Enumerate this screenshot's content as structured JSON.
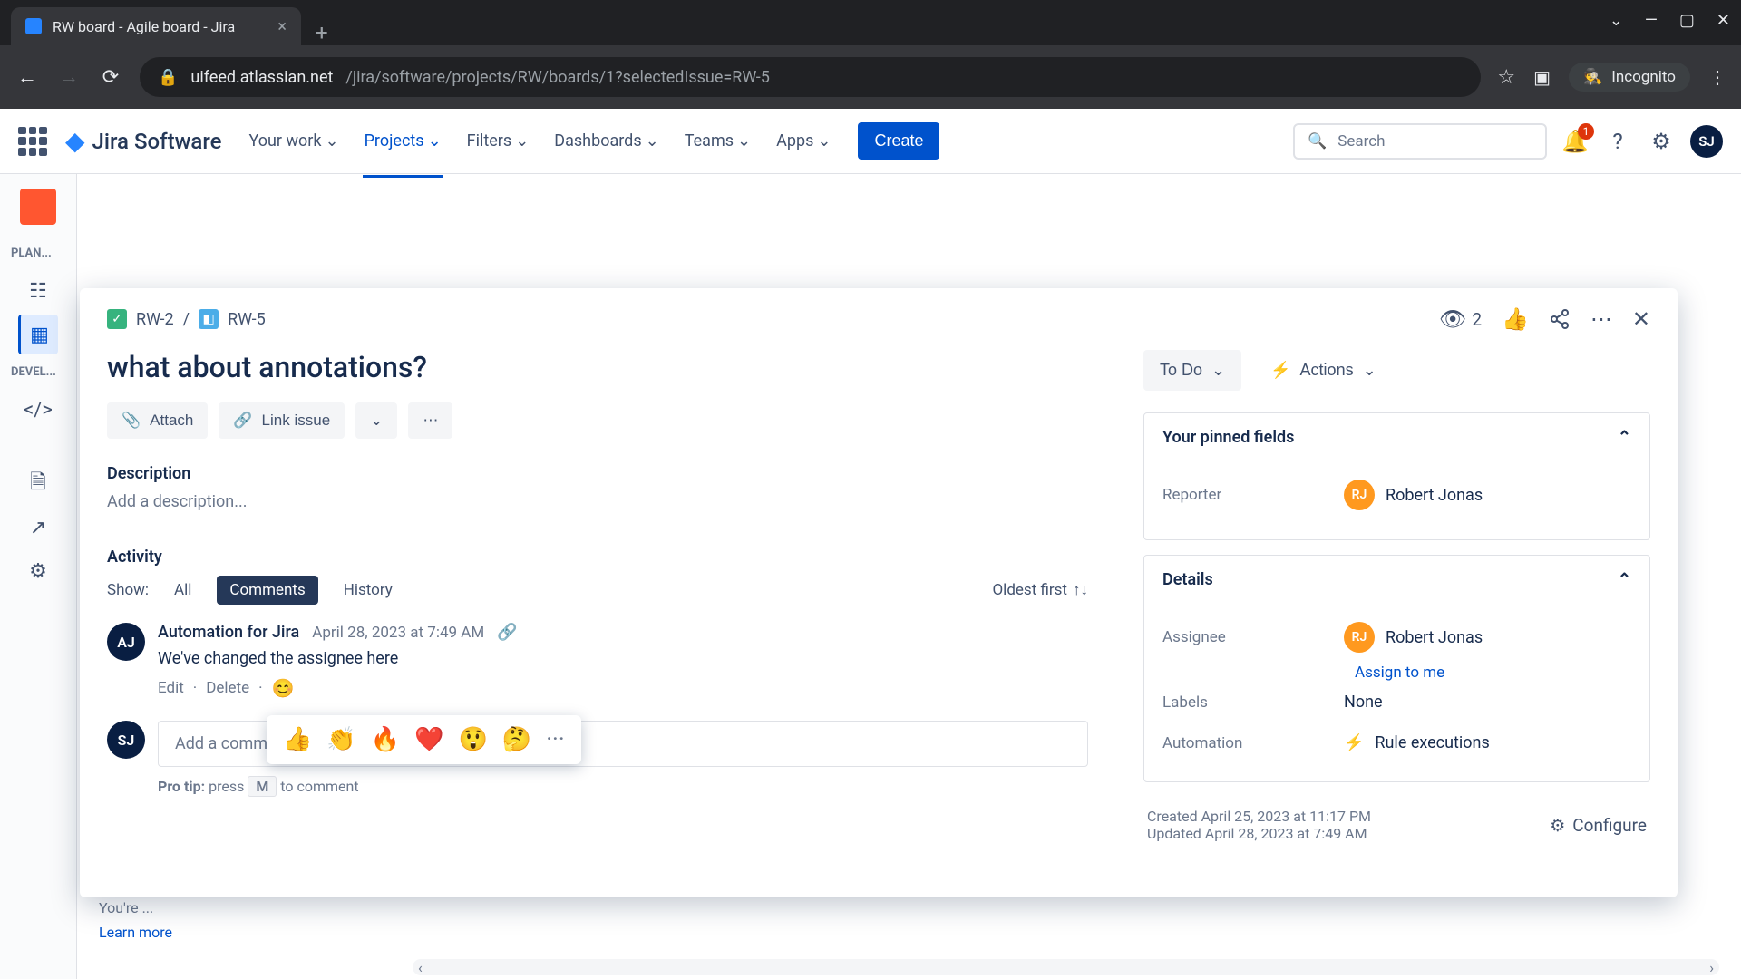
{
  "browser": {
    "tab_title": "RW board - Agile board - Jira",
    "url_domain": "uifeed.atlassian.net",
    "url_path": "/jira/software/projects/RW/boards/1?selectedIssue=RW-5",
    "incognito_label": "Incognito"
  },
  "jira_header": {
    "logo": "Jira Software",
    "nav": [
      "Your work",
      "Projects",
      "Filters",
      "Dashboards",
      "Teams",
      "Apps"
    ],
    "create": "Create",
    "search_placeholder": "Search",
    "notif_count": "1",
    "user_initials": "SJ"
  },
  "sidebar": {
    "planning_label": "PLAN...",
    "dev_label": "DEVEL..."
  },
  "breadcrumb": {
    "parent": "RW-2",
    "current": "RW-5"
  },
  "watchers": "2",
  "issue": {
    "title": "what about annotations?",
    "toolbar": {
      "attach": "Attach",
      "link": "Link issue"
    },
    "description_label": "Description",
    "description_placeholder": "Add a description...",
    "activity_label": "Activity",
    "show_label": "Show:",
    "tabs": [
      "All",
      "Comments",
      "History"
    ],
    "sort": "Oldest first"
  },
  "comment": {
    "author_initials": "AJ",
    "author": "Automation for Jira",
    "date": "April 28, 2023 at 7:49 AM",
    "text": "We've changed the assignee here",
    "edit": "Edit",
    "delete": "Delete"
  },
  "emoji": [
    "👍",
    "👏",
    "🔥",
    "❤️",
    "😲",
    "🤔",
    "···"
  ],
  "add_comment": {
    "user_initials": "SJ",
    "placeholder": "Add a comment...",
    "tip_prefix": "Pro tip:",
    "tip_press": "press",
    "tip_key": "M",
    "tip_suffix": "to comment"
  },
  "right_panel": {
    "status": "To Do",
    "actions": "Actions",
    "pinned_header": "Your pinned fields",
    "reporter_label": "Reporter",
    "reporter_initials": "RJ",
    "reporter_name": "Robert Jonas",
    "details_header": "Details",
    "assignee_label": "Assignee",
    "assignee_initials": "RJ",
    "assignee_name": "Robert Jonas",
    "assign_to_me": "Assign to me",
    "labels_label": "Labels",
    "labels_value": "None",
    "automation_label": "Automation",
    "automation_value": "Rule executions",
    "created": "Created April 25, 2023 at 11:17 PM",
    "updated": "Updated April 28, 2023 at 7:49 AM",
    "configure": "Configure"
  },
  "board_bg": {
    "text": "You're ...",
    "learn": "Learn more"
  }
}
